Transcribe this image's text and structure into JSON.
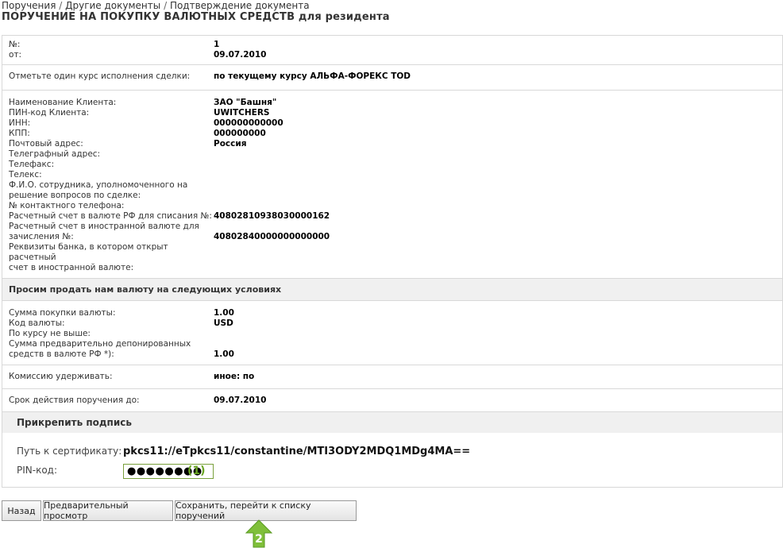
{
  "breadcrumb": [
    "Поручения",
    "Другие документы",
    "Подтверждение документа"
  ],
  "title": "ПОРУЧЕНИЕ НА ПОКУПКУ ВАЛЮТНЫХ СРЕДСТВ для резидента",
  "doc": {
    "num_label": "№:",
    "num": "1",
    "from_label": "от:",
    "date": "09.07.2010"
  },
  "rate": {
    "label": "Отметьте один курс исполнения сделки:",
    "value": "по текущему курсу АЛЬФА-ФОРЕКС TOD"
  },
  "client": {
    "name_label": "Наименование Клиента:",
    "name": "ЗАО \"Башня\"",
    "pin_label": "ПИН-код Клиента:",
    "pin": "UWITCHERS",
    "inn_label": "ИНН:",
    "inn": "000000000000",
    "kpp_label": "КПП:",
    "kpp": "000000000",
    "post_label": "Почтовый адрес:",
    "post": "Россия",
    "tele_label": "Телеграфный адрес:",
    "fax_label": "Телефакс:",
    "telex_label": "Телекс:",
    "fio_label1": "Ф.И.О. сотрудника, уполномоченного на",
    "fio_label2": "решение вопросов по сделке:",
    "phone_label": "№ контактного телефона:",
    "rub_label": "Расчетный счет в валюте РФ для списания №:",
    "rub": "40802810938030000162",
    "fx_label1": "Расчетный счет в иностранной валюте для",
    "fx_label2": "зачисления №:",
    "fx": "40802840000000000000",
    "bank_label1": "Реквизиты банка, в котором открыт расчетный",
    "bank_label2": "счет в иностранной валюте:"
  },
  "conditions": {
    "header": "Просим продать нам валюту на следующих условиях",
    "amount_label": "Сумма покупки валюты:",
    "amount": "1.00",
    "code_label": "Код валюты:",
    "code": "USD",
    "rate_label": "По курсу не выше:",
    "dep_label1": "Сумма предварительно депонированных",
    "dep_label2": "средств в валюте РФ *):",
    "dep": "1.00"
  },
  "commission": {
    "label": "Комиссию удерживать:",
    "value": "иное: по"
  },
  "validity": {
    "label": "Срок действия поручения до:",
    "value": "09.07.2010"
  },
  "signature": {
    "header": "Прикрепить подпись",
    "cert_label": "Путь к сертификату:",
    "cert_value": "pkcs11://eTpkcs11/constantine/MTI3ODY2MDQ1MDg4MA==",
    "pin_label": "PIN-код:",
    "pin_value": "●●●●●●●●",
    "pin_marker": "(1)"
  },
  "buttons": {
    "back": "Назад",
    "preview": "Предварительный просмотр",
    "save": "Сохранить, перейти к списку поручений"
  },
  "arrow_marker": "2",
  "colors": {
    "accent_green": "#6aa524"
  }
}
